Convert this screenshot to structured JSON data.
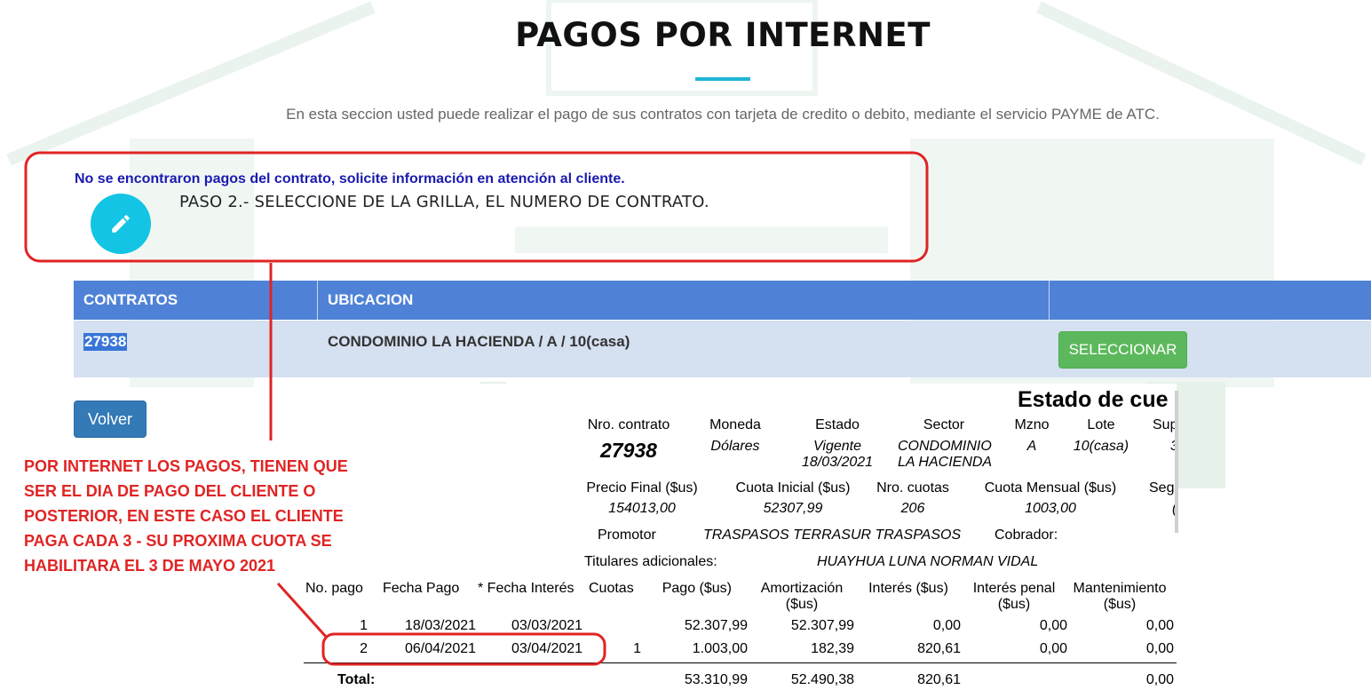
{
  "page": {
    "title": "PAGOS POR INTERNET",
    "subtitle": "En esta seccion usted puede realizar el pago de sus contratos con tarjeta de credito o debito, mediante el servicio PAYME de ATC.",
    "accent_color": "#1fb5d6"
  },
  "alert": {
    "message": "No se encontraron pagos del contrato, solicite información en atención al cliente.",
    "step": "PASO 2.- SELECCIONE DE LA GRILLA, EL NUMERO DE CONTRATO.",
    "icon": "pencil-icon"
  },
  "grid": {
    "headers": [
      "CONTRATOS",
      "UBICACION",
      ""
    ],
    "rows": [
      {
        "contract": "27938",
        "location": "CONDOMINIO LA HACIENDA / A / 10(casa)",
        "action": "SELECCIONAR"
      }
    ],
    "header_color": "#4f82d6",
    "row_color": "#d5e0f1"
  },
  "back_button": "Volver",
  "statement": {
    "title": "Estado de cue",
    "info": {
      "labels": [
        "Nro. contrato",
        "Moneda",
        "Estado",
        "Sector",
        "Mzno",
        "Lote",
        "Sup"
      ],
      "contract": "27938",
      "currency": "Dólares",
      "status": "Vigente",
      "status_date": "18/03/2021",
      "sector_line1": "CONDOMINIO",
      "sector_line2": "LA HACIENDA",
      "block": "A",
      "lot": "10(casa)",
      "sup": "3"
    },
    "amounts": {
      "labels": [
        "Precio Final ($us)",
        "Cuota Inicial ($us)",
        "Nro. cuotas",
        "Cuota Mensual ($us)",
        "Seg."
      ],
      "values": [
        "154013,00",
        "52307,99",
        "206",
        "1003,00",
        "("
      ]
    },
    "promotor_label": "Promotor",
    "promotor": "TRASPASOS TERRASUR TRASPASOS",
    "cobrador_label": "Cobrador:",
    "titulares_label": "Titulares adicionales:",
    "titulares": "HUAYHUA LUNA NORMAN VIDAL",
    "table": {
      "headers": [
        "No. pago",
        "Fecha Pago",
        "* Fecha Interés",
        "Cuotas",
        "Pago ($us)",
        "Amortización",
        "Interés ($us)",
        "Interés penal",
        "Mantenimiento"
      ],
      "headers_sub": [
        "($us)",
        "($us)",
        "($us)"
      ],
      "rows": [
        [
          "1",
          "18/03/2021",
          "03/03/2021",
          "",
          "52.307,99",
          "52.307,99",
          "0,00",
          "0,00",
          "0,00"
        ],
        [
          "2",
          "06/04/2021",
          "03/04/2021",
          "1",
          "1.003,00",
          "182,39",
          "820,61",
          "0,00",
          "0,00"
        ]
      ],
      "total": [
        "Total:",
        "53.310,99",
        "52.490,38",
        "820,61",
        "0,00"
      ]
    }
  },
  "annotation": {
    "lines": [
      "POR INTERNET LOS PAGOS, TIENEN QUE",
      "SER EL DIA DE PAGO DEL CLIENTE O",
      "POSTERIOR, EN ESTE CASO EL CLIENTE",
      "PAGA CADA 3 - SU PROXIMA CUOTA SE",
      "HABILITARA EL 3 DE MAYO 2021"
    ],
    "color": "#e02424"
  }
}
